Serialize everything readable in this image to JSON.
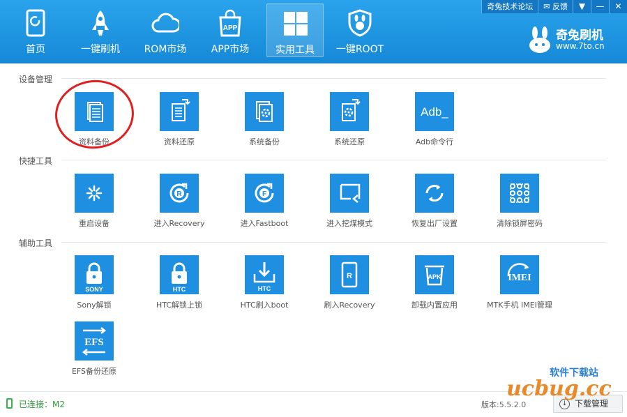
{
  "topbar": {
    "forum": "奇兔技术论坛",
    "feedback": "反馈",
    "menu": "▼",
    "minimize": "—",
    "close": "✕"
  },
  "nav": [
    {
      "label": "首页",
      "icon": "phone-icon"
    },
    {
      "label": "一键刷机",
      "icon": "rocket-icon"
    },
    {
      "label": "ROM市场",
      "icon": "cloud-icon"
    },
    {
      "label": "APP市场",
      "icon": "shopping-bag-icon"
    },
    {
      "label": "实用工具",
      "icon": "grid-icon",
      "active": true
    },
    {
      "label": "一键ROOT",
      "icon": "rabbit-shield-icon"
    }
  ],
  "brand": {
    "name": "奇兔刷机",
    "url": "www.7to.cn"
  },
  "sections": [
    {
      "title": "设备管理",
      "tiles": [
        {
          "label": "资料备份",
          "icon": "document-backup-icon"
        },
        {
          "label": "资料还原",
          "icon": "document-restore-icon"
        },
        {
          "label": "系统备份",
          "icon": "system-backup-icon"
        },
        {
          "label": "系统还原",
          "icon": "system-restore-icon"
        },
        {
          "label": "Adb命令行",
          "icon": "adb-terminal-icon",
          "text": "Adb_"
        }
      ]
    },
    {
      "title": "快捷工具",
      "tiles": [
        {
          "label": "重启设备",
          "icon": "reboot-spinner-icon"
        },
        {
          "label": "进入Recovery",
          "icon": "recovery-icon",
          "text": "R"
        },
        {
          "label": "进入Fastboot",
          "icon": "fastboot-icon",
          "text": "F"
        },
        {
          "label": "进入挖煤模式",
          "icon": "download-mode-icon"
        },
        {
          "label": "恢复出厂设置",
          "icon": "factory-reset-icon"
        },
        {
          "label": "清除锁屏密码",
          "icon": "pattern-lock-icon"
        }
      ]
    },
    {
      "title": "辅助工具",
      "tiles": [
        {
          "label": "Sony解锁",
          "icon": "sony-unlock-icon",
          "text": "SONY"
        },
        {
          "label": "HTC解锁上锁",
          "icon": "htc-lock-icon",
          "text": "HTC"
        },
        {
          "label": "HTC刷入boot",
          "icon": "htc-boot-icon",
          "text": "HTC"
        },
        {
          "label": "刷入Recovery",
          "icon": "flash-recovery-icon",
          "text": "R"
        },
        {
          "label": "卸载内置应用",
          "icon": "uninstall-apk-icon",
          "text": "APK"
        },
        {
          "label": "MTK手机 IMEI管理",
          "icon": "imei-icon",
          "text": "IMEI"
        },
        {
          "label": "EFS备份还原",
          "icon": "efs-icon",
          "text": "EFS"
        }
      ]
    }
  ],
  "status": {
    "connection": "已连接：M2",
    "version": "版本:5.5.2.0",
    "download_manager": "下载管理"
  },
  "watermark": {
    "line1": "软件下载站",
    "line2": "ucbug.cc"
  },
  "colors": {
    "header": "#1e8fe1",
    "tile": "#1e8fe1",
    "highlight_circle": "#e02020",
    "connected": "#2d9a3b"
  }
}
